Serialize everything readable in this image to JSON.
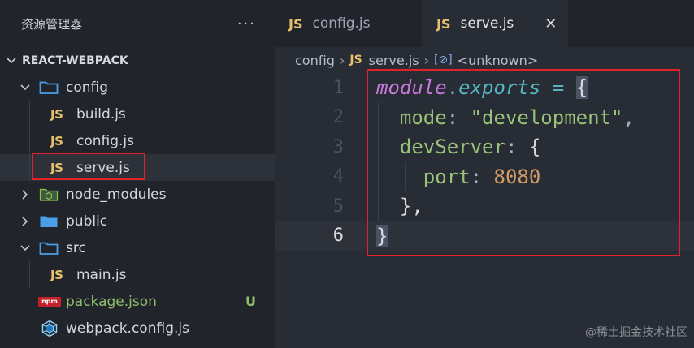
{
  "sidebar": {
    "title": "资源管理器",
    "more": "···",
    "root": "REACT-WEBPACK",
    "items": [
      {
        "label": "config",
        "type": "folder"
      },
      {
        "label": "build.js",
        "type": "js"
      },
      {
        "label": "config.js",
        "type": "js"
      },
      {
        "label": "serve.js",
        "type": "js"
      },
      {
        "label": "node_modules",
        "type": "folder"
      },
      {
        "label": "public",
        "type": "folder"
      },
      {
        "label": "src",
        "type": "folder"
      },
      {
        "label": "main.js",
        "type": "js"
      },
      {
        "label": "package.json",
        "type": "npm",
        "badge": "U"
      },
      {
        "label": "webpack.config.js",
        "type": "webpack"
      }
    ],
    "js_icon": "JS",
    "npm_icon": "npm"
  },
  "tabs": [
    {
      "icon": "JS",
      "label": "config.js",
      "active": false
    },
    {
      "icon": "JS",
      "label": "serve.js",
      "active": true,
      "close": "✕"
    }
  ],
  "breadcrumb": {
    "parts": [
      "config",
      "serve.js",
      "<unknown>"
    ],
    "sep": "›",
    "js_icon": "JS",
    "symbol_icon": "[⊘]"
  },
  "code": {
    "line_numbers": [
      "1",
      "2",
      "3",
      "4",
      "5",
      "6"
    ],
    "current_line": "6",
    "l1": {
      "kw": "module",
      "dot": ".",
      "prop": "exports",
      "op": " = ",
      "brace": "{"
    },
    "l2": {
      "indent": "  ",
      "key": "mode",
      "colon": ": ",
      "str": "\"development\"",
      "comma": ","
    },
    "l3": {
      "indent": "  ",
      "key": "devServer",
      "colon": ": ",
      "brace": "{"
    },
    "l4": {
      "indent": "    ",
      "key": "port",
      "colon": ": ",
      "num": "8080"
    },
    "l5": {
      "indent": "  ",
      "text": "},"
    },
    "l6": {
      "brace": "}"
    }
  },
  "watermark": "@稀土掘金技术社区",
  "colors": {
    "highlight_box": "#e0222a",
    "js_icon": "#e8bf6a",
    "folder": "#4a9fe8",
    "keyword": "#c678dd",
    "string": "#98c379",
    "number": "#d19a66"
  }
}
